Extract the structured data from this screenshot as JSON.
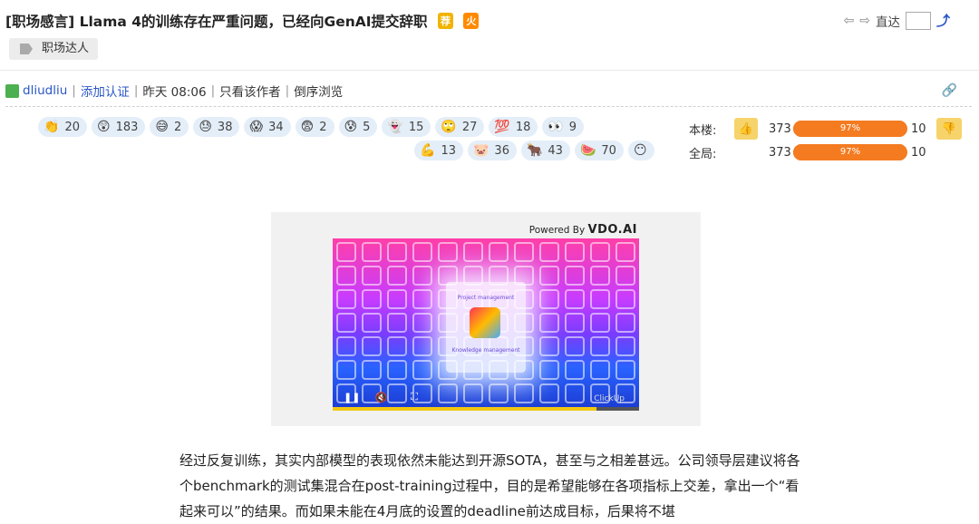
{
  "thread": {
    "title": "[职场感言] Llama 4的训练存在严重问题，已经向GenAI提交辞职",
    "badge_a": "荐",
    "badge_b": "火",
    "tag": "职场达人"
  },
  "nav": {
    "jump_label": "直达"
  },
  "post": {
    "author": "dliudliu",
    "add_cert": "添加认证",
    "time": "昨天 08:06",
    "only_author": "只看该作者",
    "reverse": "倒序浏览"
  },
  "reactions": {
    "row1": [
      {
        "emoji": "👏",
        "count": "20"
      },
      {
        "emoji": "😲",
        "count": "183"
      },
      {
        "emoji": "😅",
        "count": "2"
      },
      {
        "emoji": "😓",
        "count": "38"
      },
      {
        "emoji": "😱",
        "count": "34"
      },
      {
        "emoji": "😨",
        "count": "2"
      },
      {
        "emoji": "😰",
        "count": "5"
      },
      {
        "emoji": "👻",
        "count": "15"
      },
      {
        "emoji": "🙄",
        "count": "27"
      },
      {
        "emoji": "💯",
        "count": "18"
      },
      {
        "emoji": "👀",
        "count": "9"
      }
    ],
    "row2": [
      {
        "emoji": "💪",
        "count": "13"
      },
      {
        "emoji": "🐷",
        "count": "36"
      },
      {
        "emoji": "🐂",
        "count": "43"
      },
      {
        "emoji": "🍉",
        "count": "70"
      },
      {
        "emoji": "😶",
        "count": ""
      }
    ]
  },
  "rating": {
    "floor_label": "本楼:",
    "global_label": "全局:",
    "floor_up": "373",
    "floor_pct": "97%",
    "floor_pct_value": 97,
    "floor_down": "10",
    "global_up": "373",
    "global_pct": "97%",
    "global_pct_value": 97,
    "global_down": "10"
  },
  "video": {
    "powered_by": "Powered By",
    "brand": "VDO.AI",
    "card_top": "Project management",
    "card_bottom": "Knowledge management",
    "watermark": "ClickUp",
    "progress_pct": 86
  },
  "content": {
    "paragraph": "经过反复训练，其实内部模型的表现依然未能达到开源SOTA，甚至与之相差甚远。公司领导层建议将各个benchmark的测试集混合在post-training过程中，目的是希望能够在各项指标上交差，拿出一个“看起来可以”的结果。而如果未能在4月底的设置的deadline前达成目标，后果将不堪"
  },
  "colors": {
    "link": "#2a57c6",
    "reaction_bg": "#e4eef8",
    "bar": "#f47b20",
    "thumb": "#f6d36b"
  },
  "icons": {
    "tag": "tag-icon",
    "back": "arrow-left-icon",
    "forward": "arrow-right-icon",
    "jump": "jump-icon",
    "link": "link-icon",
    "avatar": "avatar-icon"
  }
}
